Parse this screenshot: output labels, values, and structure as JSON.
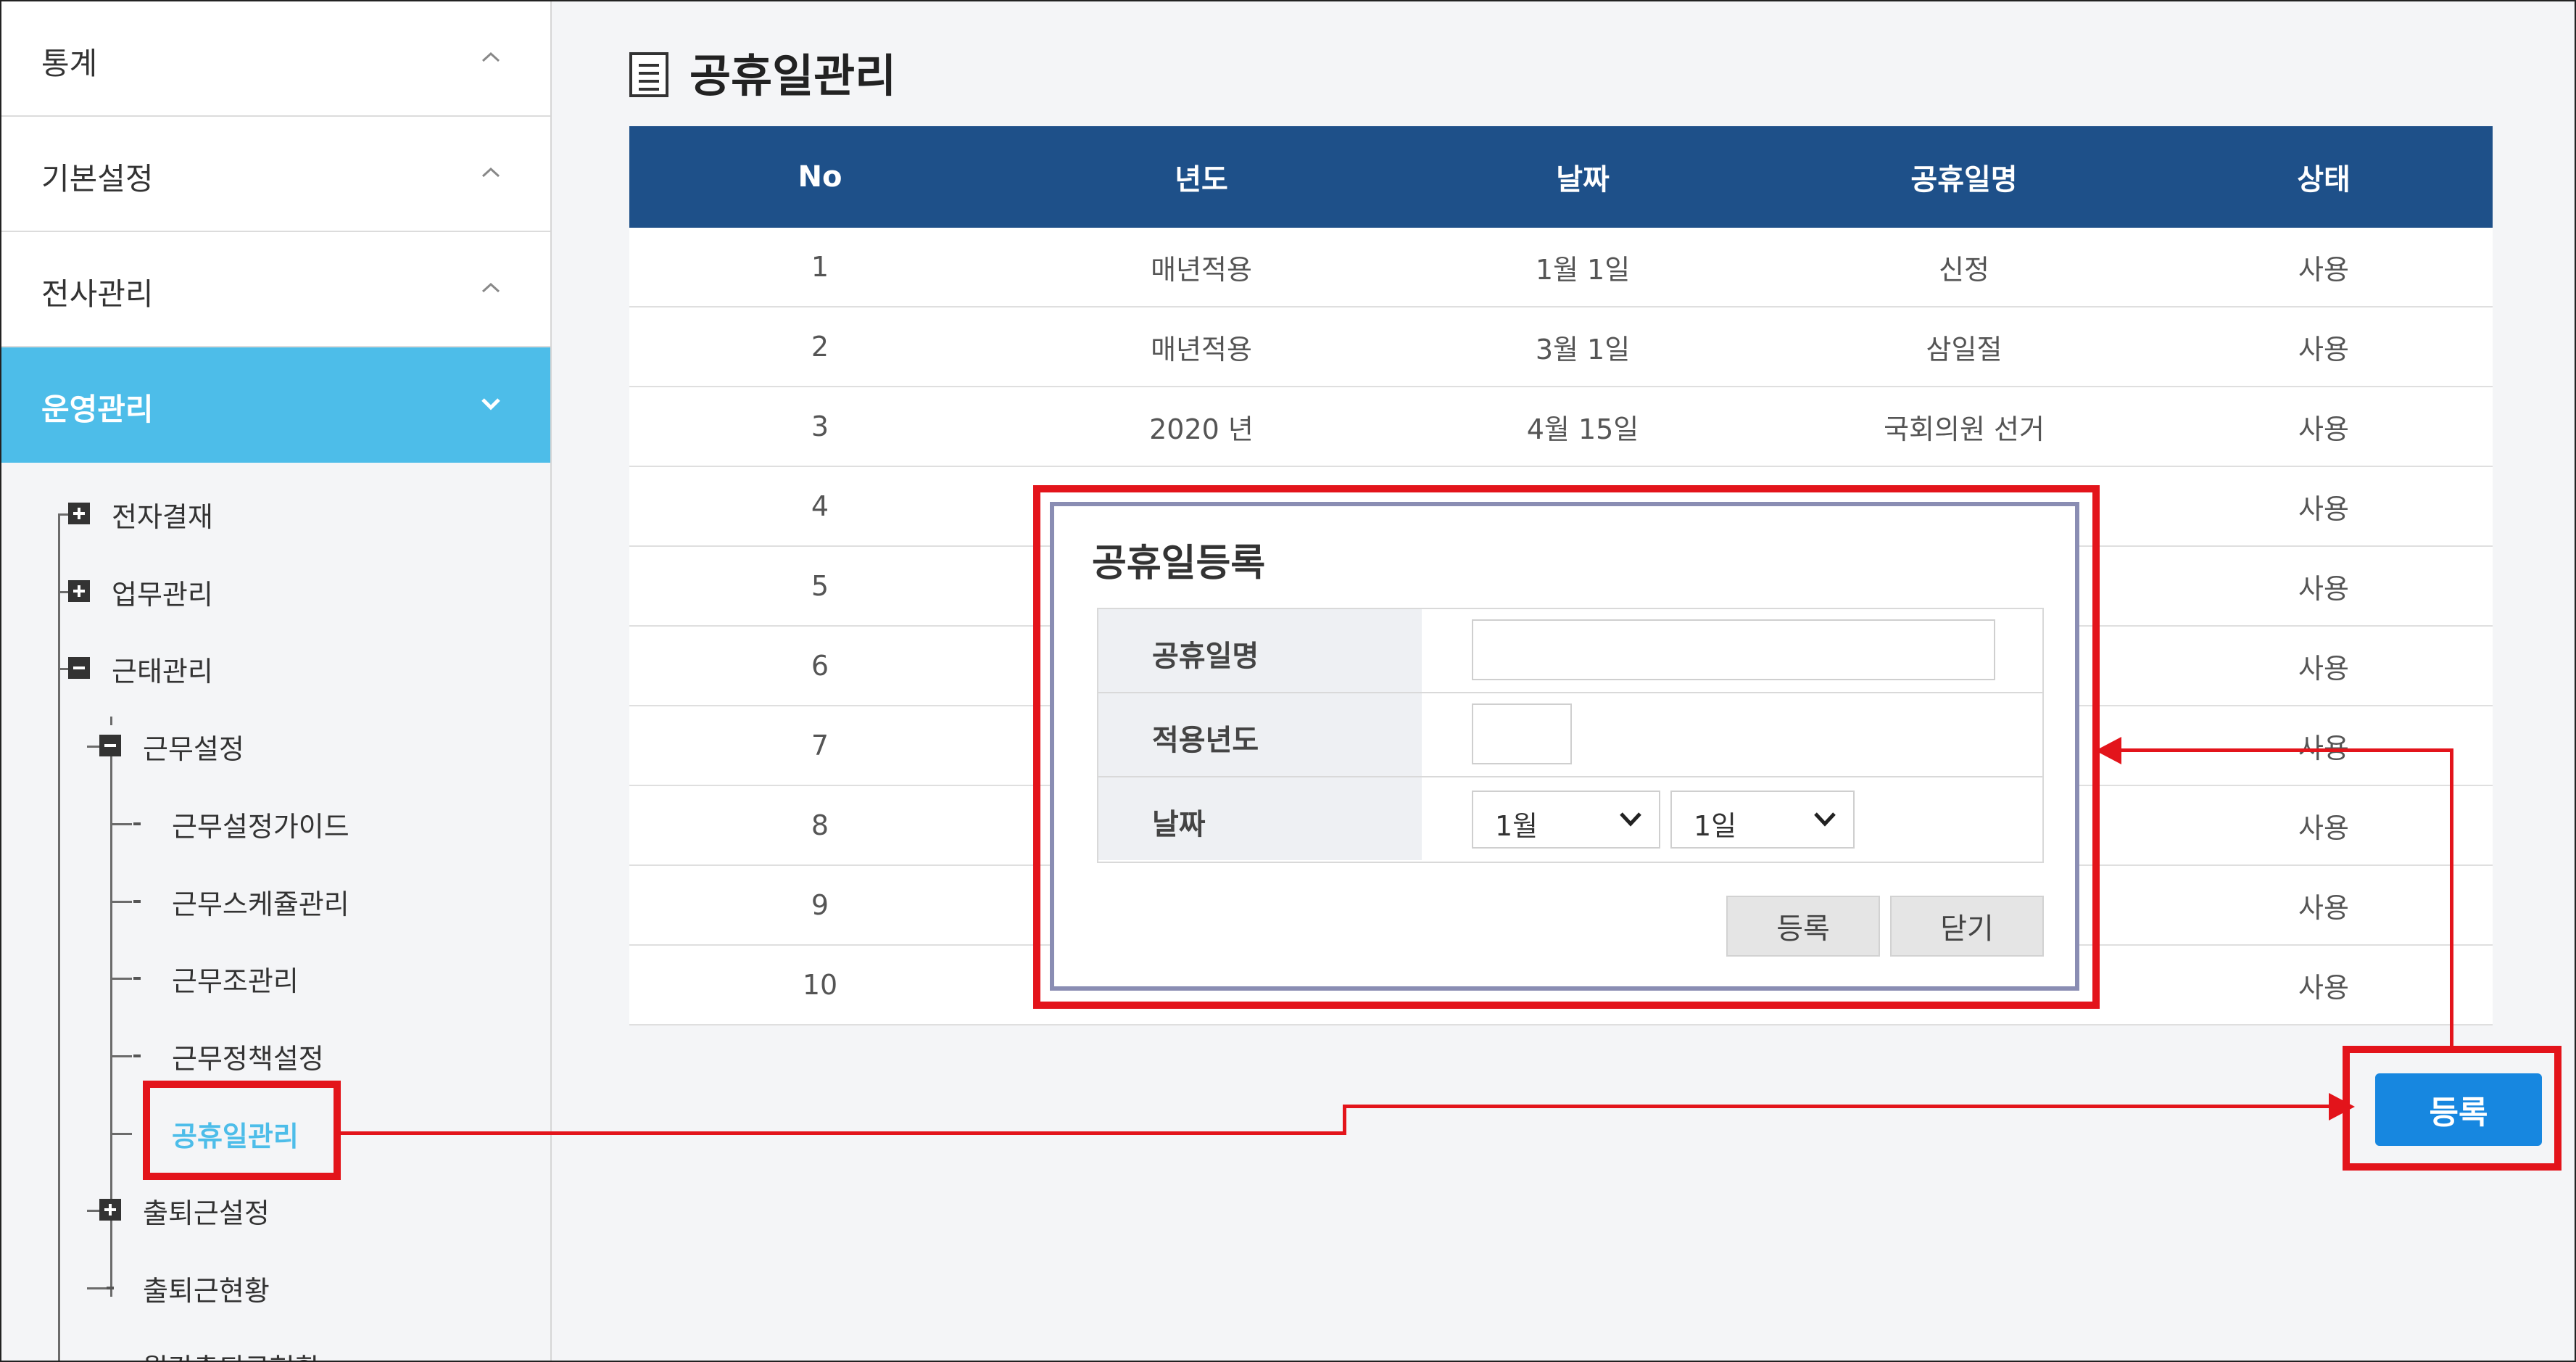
{
  "sidebar": {
    "menu": [
      {
        "label": "통계"
      },
      {
        "label": "기본설정"
      },
      {
        "label": "전사관리"
      },
      {
        "label": "운영관리"
      }
    ],
    "tree": {
      "approval": "전자결재",
      "work": "업무관리",
      "attendance": "근태관리",
      "work_settings": "근무설정",
      "guide": "근무설정가이드",
      "schedule": "근무스케쥴관리",
      "group": "근무조관리",
      "policy": "근무정책설정",
      "holiday": "공휴일관리",
      "commute_settings": "출퇴근설정",
      "commute_status": "출퇴근현황",
      "monthly_partial": "월간출퇴근현황"
    }
  },
  "main": {
    "title": "공휴일관리",
    "columns": [
      "No",
      "년도",
      "날짜",
      "공휴일명",
      "상태"
    ],
    "rows": [
      [
        "1",
        "매년적용",
        "1월 1일",
        "신정",
        "사용"
      ],
      [
        "2",
        "매년적용",
        "3월 1일",
        "삼일절",
        "사용"
      ],
      [
        "3",
        "2020 년",
        "4월 15일",
        "국회의원 선거",
        "사용"
      ],
      [
        "4",
        "",
        "",
        "",
        "사용"
      ],
      [
        "5",
        "",
        "",
        "",
        "사용"
      ],
      [
        "6",
        "",
        "",
        "",
        "사용"
      ],
      [
        "7",
        "",
        "",
        "",
        "사용"
      ],
      [
        "8",
        "",
        "",
        "",
        "사용"
      ],
      [
        "9",
        "",
        "",
        "",
        "사용"
      ],
      [
        "10",
        "",
        "",
        "",
        "사용"
      ]
    ],
    "register_button": "등록"
  },
  "modal": {
    "title": "공휴일등록",
    "labels": {
      "name": "공휴일명",
      "year": "적용년도",
      "date": "날짜"
    },
    "values": {
      "name": "",
      "year": "",
      "month": "1월",
      "day": "1일"
    },
    "register": "등록",
    "close": "닫기"
  },
  "colors": {
    "header": "#1e5089",
    "accent": "#4dbde9",
    "button": "#1787e0",
    "highlight": "#e3141b"
  }
}
